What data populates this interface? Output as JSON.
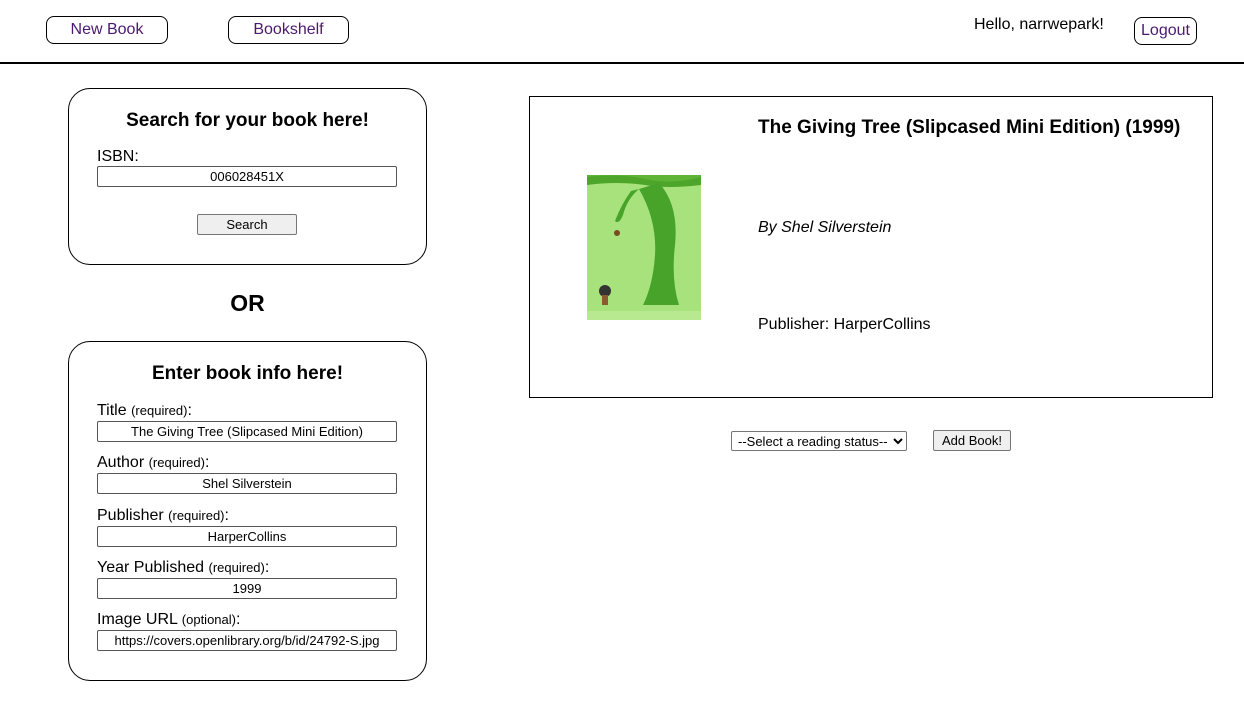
{
  "header": {
    "new_book_label": "New Book",
    "bookshelf_label": "Bookshelf",
    "greeting": "Hello, narrwepark!",
    "logout_label": "Logout",
    "link_color": "#4b1a70"
  },
  "search_panel": {
    "title": "Search for your book here!",
    "isbn_label": "ISBN:",
    "isbn_value": "006028451X",
    "search_button": "Search"
  },
  "or_text": "OR",
  "info_panel": {
    "title": "Enter book info here!",
    "fields": [
      {
        "label": "Title",
        "note": "(required)",
        "value": "The Giving Tree (Slipcased Mini Edition)"
      },
      {
        "label": "Author",
        "note": "(required)",
        "value": "Shel Silverstein"
      },
      {
        "label": "Publisher",
        "note": "(required)",
        "value": "HarperCollins"
      },
      {
        "label": "Year Published",
        "note": "(required)",
        "value": "1999"
      },
      {
        "label": "Image URL",
        "note": "(optional)",
        "value": "https://covers.openlibrary.org/b/id/24792-S.jpg"
      }
    ]
  },
  "preview": {
    "title": "The Giving Tree (Slipcased Mini Edition) (1999)",
    "author": "By Shel Silverstein",
    "publisher": "Publisher: HarperCollins",
    "cover_icon": "book-cover-tree-image"
  },
  "actions": {
    "status_selected": "--Select a reading status--",
    "add_button": "Add Book!"
  }
}
